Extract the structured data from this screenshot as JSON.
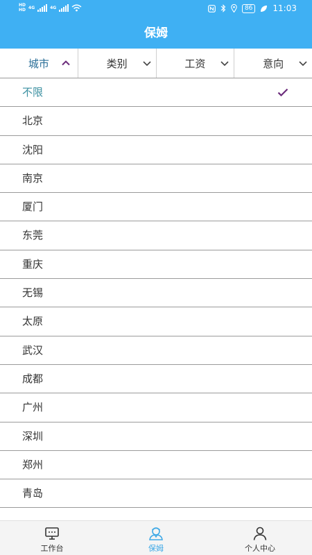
{
  "status_bar": {
    "sim1": "HD",
    "sim2": "HD",
    "net1": "4G",
    "net2": "4G",
    "battery": "86",
    "time": "11:03"
  },
  "header": {
    "title": "保姆"
  },
  "filters": [
    {
      "label": "城市",
      "active": true
    },
    {
      "label": "类别",
      "active": false
    },
    {
      "label": "工资",
      "active": false
    },
    {
      "label": "意向",
      "active": false
    }
  ],
  "cities": [
    {
      "label": "不限",
      "selected": true
    },
    {
      "label": "北京"
    },
    {
      "label": "沈阳"
    },
    {
      "label": "南京"
    },
    {
      "label": "厦门"
    },
    {
      "label": "东莞"
    },
    {
      "label": "重庆"
    },
    {
      "label": "无锡"
    },
    {
      "label": "太原"
    },
    {
      "label": "武汉"
    },
    {
      "label": "成都"
    },
    {
      "label": "广州"
    },
    {
      "label": "深圳"
    },
    {
      "label": "郑州"
    },
    {
      "label": "青岛"
    },
    {
      "label": ""
    }
  ],
  "bottom_nav": [
    {
      "label": "工作台",
      "icon": "monitor-icon",
      "active": false
    },
    {
      "label": "保姆",
      "icon": "nanny-icon",
      "active": true
    },
    {
      "label": "个人中心",
      "icon": "person-icon",
      "active": false
    }
  ],
  "colors": {
    "primary": "#3fb0f3",
    "active_filter": "#2b6f98",
    "selected_city": "#3a8fa0",
    "check_mark": "#6a2a7a",
    "nav_active": "#3fa9e6"
  }
}
